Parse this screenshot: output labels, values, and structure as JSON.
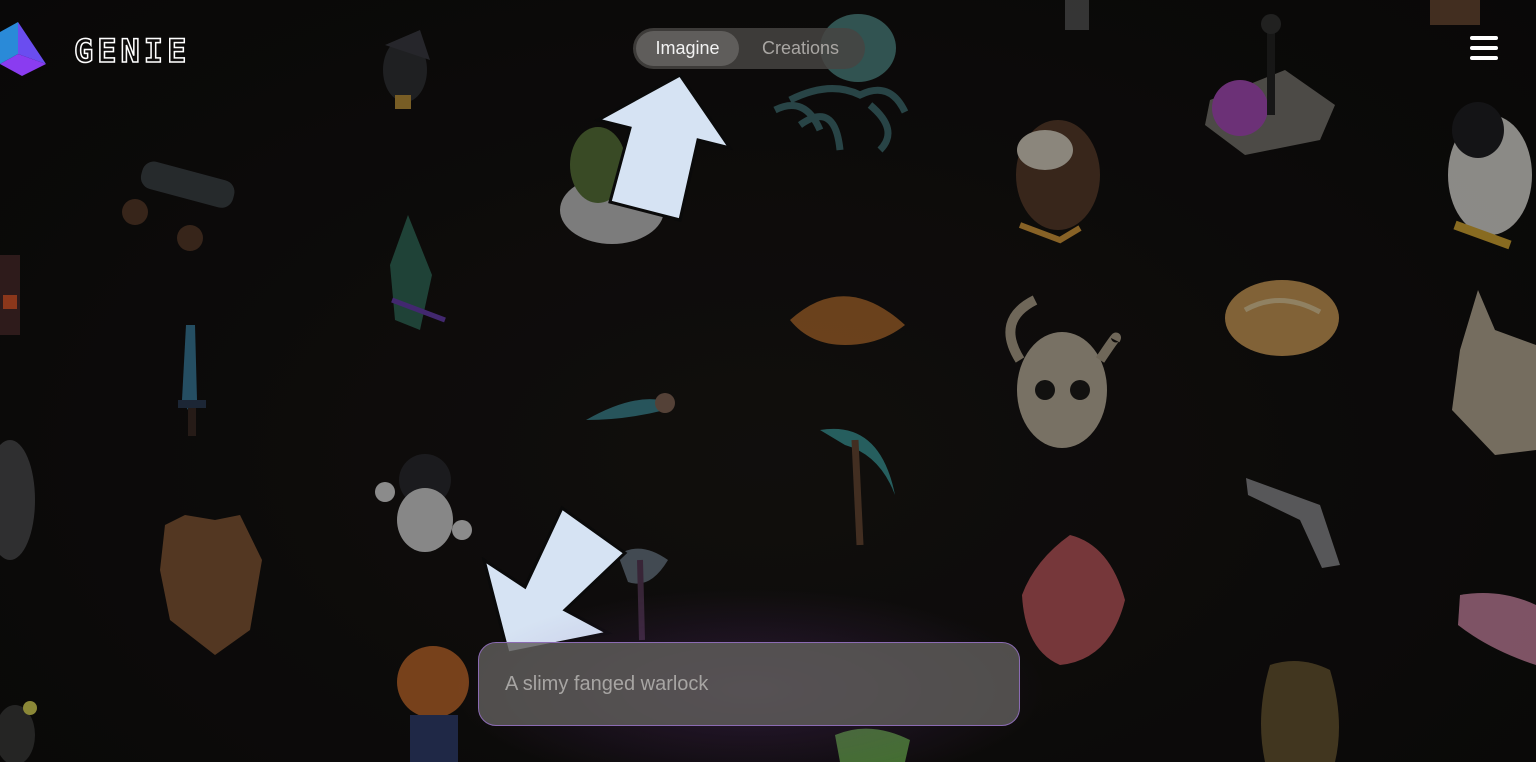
{
  "app": {
    "name": "GENIE"
  },
  "header": {
    "tabs": [
      {
        "label": "Imagine",
        "active": true
      },
      {
        "label": "Creations",
        "active": false
      }
    ],
    "menu_icon": "hamburger-menu-icon"
  },
  "prompt": {
    "value": "",
    "placeholder": "A slimy fanged warlock"
  },
  "annotations": [
    "up-arrow-pointing-to-imagine-tab",
    "down-left-arrow-pointing-to-prompt-input"
  ],
  "gallery": [
    "bird",
    "octopus",
    "lamp-post-on-flowers",
    "penguin-astronaut",
    "cannon",
    "cactus-pot",
    "owl",
    "crystal",
    "croissant",
    "bread-loaf",
    "sword",
    "horned-skull",
    "helmet-mask",
    "dagger",
    "scythe",
    "revolver",
    "cartoon-dog",
    "teddy-bear",
    "wolf-mask",
    "axe",
    "anatomical-heart",
    "fish-skull",
    "pumpkin-head-figure",
    "gorilla-bust"
  ],
  "colors": {
    "background": "#0f0d0c",
    "prompt_border": "#8b6bb3",
    "tab_active": "#5f5d5b",
    "arrow": "#d6e3f3"
  }
}
